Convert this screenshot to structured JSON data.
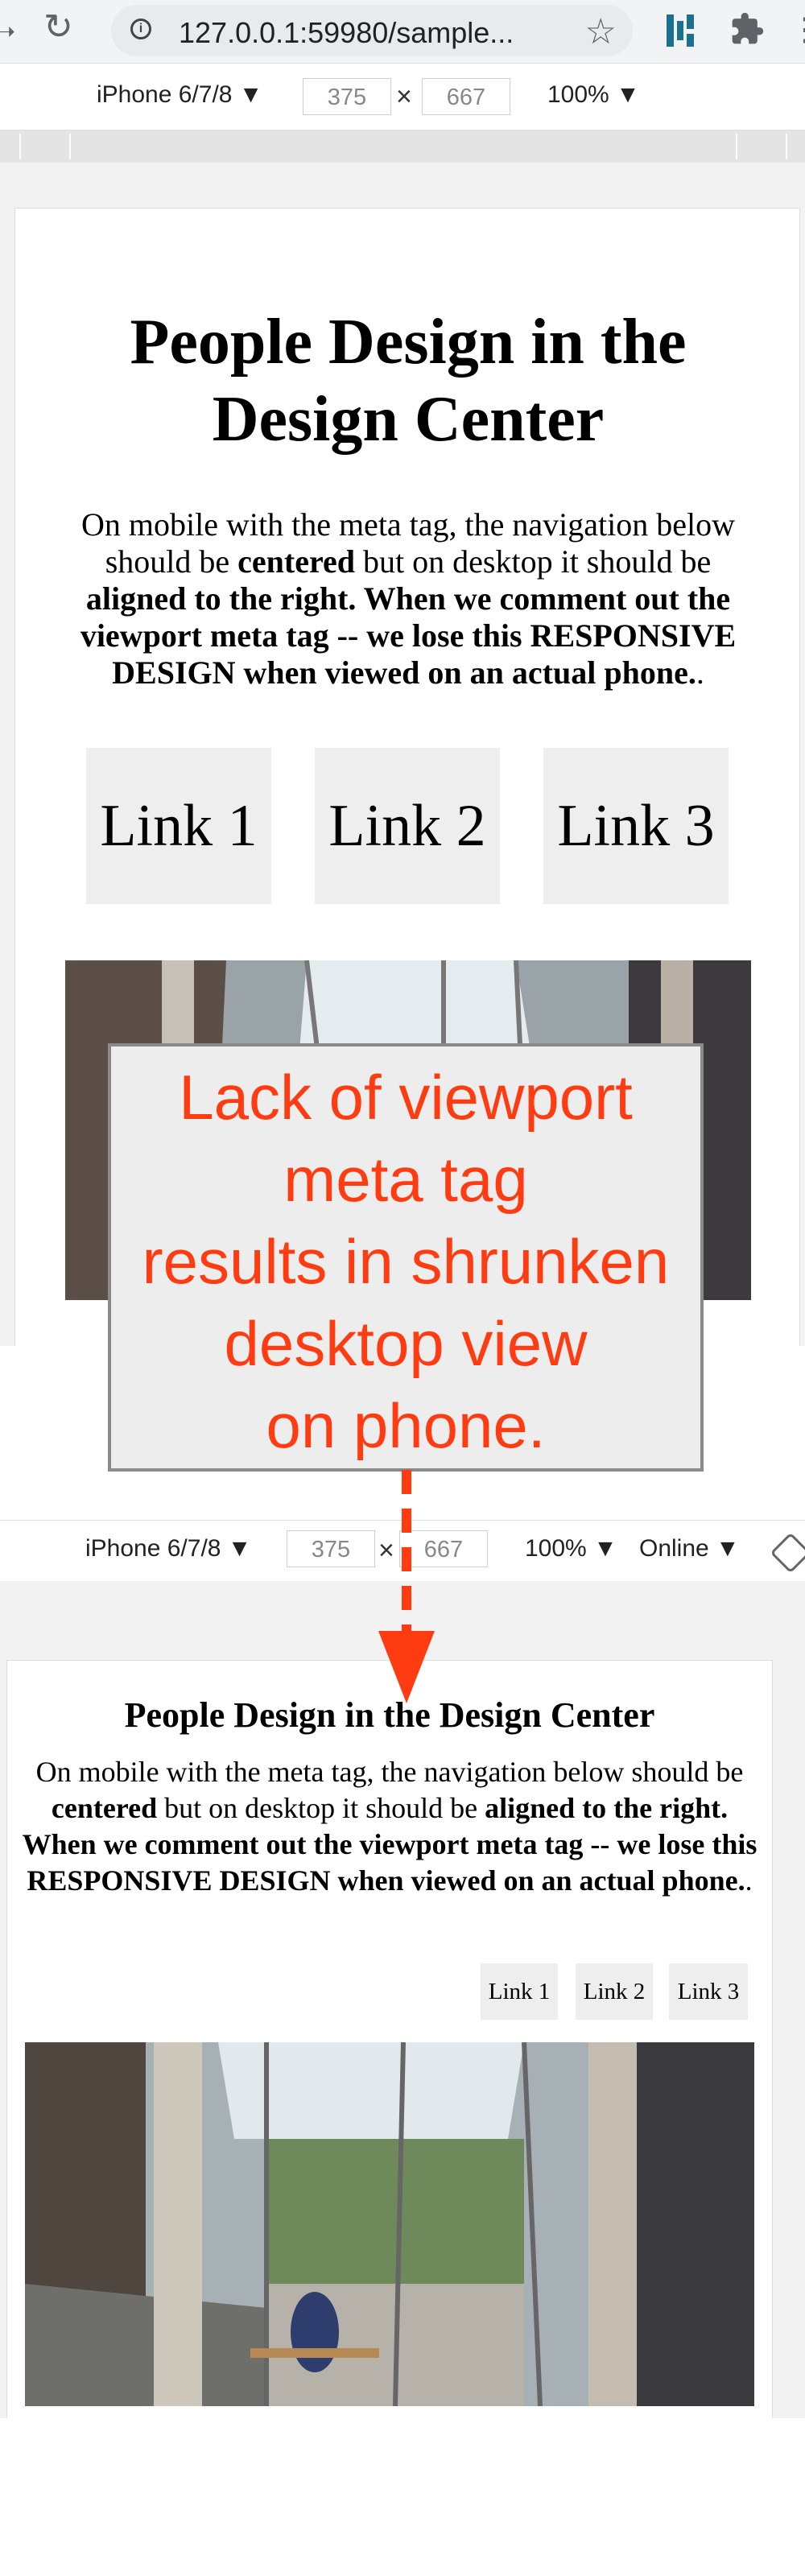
{
  "browser": {
    "url": "127.0.0.1:59980/sample...",
    "icons": [
      "back-arrow-icon",
      "reload-icon",
      "info-icon",
      "star-icon",
      "extension-icon",
      "puzzle-icon"
    ]
  },
  "device_toolbar_top": {
    "device": "iPhone 6/7/8 ▼",
    "width": "375",
    "height": "667",
    "zoom": "100% ▼"
  },
  "device_toolbar_bottom": {
    "device": "iPhone 6/7/8 ▼",
    "width": "375",
    "height": "667",
    "zoom": "100% ▼",
    "throttle": "Online ▼"
  },
  "page": {
    "title_line1": "People Design in the",
    "title_line2": "Design Center",
    "title_full": "People Design in the Design Center",
    "text_a": "On mobile with the meta tag, the navigation below should be ",
    "text_b": "centered",
    "text_c": " but on desktop it should be ",
    "text_d": "aligned to the right. When we comment out the viewport meta tag -- we lose this RESPONSIVE DESIGN when viewed on an actual phone.",
    "text_e": ".",
    "links": [
      "Link 1",
      "Link 2",
      "Link 3"
    ]
  },
  "callout": {
    "lines": [
      "Lack of viewport",
      "meta tag",
      "results in shrunken",
      "desktop view",
      "on phone."
    ],
    "color": "#ff3b12"
  }
}
